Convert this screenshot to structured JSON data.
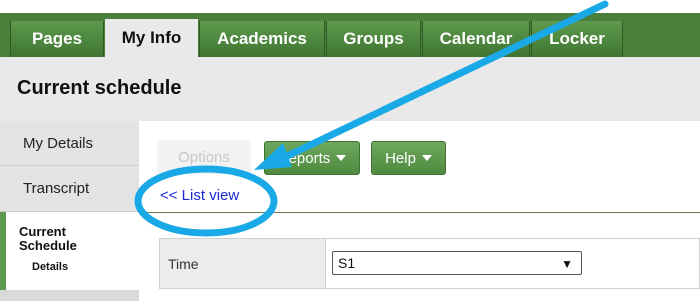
{
  "tabs": [
    {
      "label": "Pages",
      "active": false
    },
    {
      "label": "My Info",
      "active": true
    },
    {
      "label": "Academics",
      "active": false
    },
    {
      "label": "Groups",
      "active": false
    },
    {
      "label": "Calendar",
      "active": false
    },
    {
      "label": "Locker",
      "active": false
    }
  ],
  "page_title": "Current schedule",
  "sidebar": {
    "items": [
      {
        "label": "My Details"
      },
      {
        "label": "Transcript"
      }
    ],
    "active_item": {
      "label": "Current Schedule",
      "sub_label": "Details"
    }
  },
  "toolbar": {
    "options_label": "Options",
    "reports_label": "Reports",
    "help_label": "Help"
  },
  "list_view_link": "<< List view",
  "filter": {
    "label": "Time",
    "value": "S1"
  },
  "colors": {
    "nav_green": "#4b7f3c",
    "annotation_blue": "#18a9e6",
    "link_blue": "#1a2ad6"
  },
  "annotations": {
    "arrow_icon": "arrow-icon",
    "circle": "highlight-circle"
  }
}
